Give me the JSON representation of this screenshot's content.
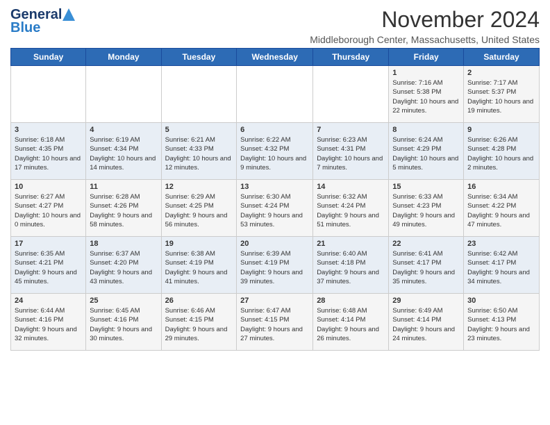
{
  "header": {
    "logo": {
      "general": "General",
      "blue": "Blue"
    },
    "title": "November 2024",
    "location": "Middleborough Center, Massachusetts, United States"
  },
  "days_of_week": [
    "Sunday",
    "Monday",
    "Tuesday",
    "Wednesday",
    "Thursday",
    "Friday",
    "Saturday"
  ],
  "weeks": [
    {
      "days": [
        {
          "num": "",
          "info": ""
        },
        {
          "num": "",
          "info": ""
        },
        {
          "num": "",
          "info": ""
        },
        {
          "num": "",
          "info": ""
        },
        {
          "num": "",
          "info": ""
        },
        {
          "num": "1",
          "info": "Sunrise: 7:16 AM\nSunset: 5:38 PM\nDaylight: 10 hours and 22 minutes."
        },
        {
          "num": "2",
          "info": "Sunrise: 7:17 AM\nSunset: 5:37 PM\nDaylight: 10 hours and 19 minutes."
        }
      ]
    },
    {
      "days": [
        {
          "num": "3",
          "info": "Sunrise: 6:18 AM\nSunset: 4:35 PM\nDaylight: 10 hours and 17 minutes."
        },
        {
          "num": "4",
          "info": "Sunrise: 6:19 AM\nSunset: 4:34 PM\nDaylight: 10 hours and 14 minutes."
        },
        {
          "num": "5",
          "info": "Sunrise: 6:21 AM\nSunset: 4:33 PM\nDaylight: 10 hours and 12 minutes."
        },
        {
          "num": "6",
          "info": "Sunrise: 6:22 AM\nSunset: 4:32 PM\nDaylight: 10 hours and 9 minutes."
        },
        {
          "num": "7",
          "info": "Sunrise: 6:23 AM\nSunset: 4:31 PM\nDaylight: 10 hours and 7 minutes."
        },
        {
          "num": "8",
          "info": "Sunrise: 6:24 AM\nSunset: 4:29 PM\nDaylight: 10 hours and 5 minutes."
        },
        {
          "num": "9",
          "info": "Sunrise: 6:26 AM\nSunset: 4:28 PM\nDaylight: 10 hours and 2 minutes."
        }
      ]
    },
    {
      "days": [
        {
          "num": "10",
          "info": "Sunrise: 6:27 AM\nSunset: 4:27 PM\nDaylight: 10 hours and 0 minutes."
        },
        {
          "num": "11",
          "info": "Sunrise: 6:28 AM\nSunset: 4:26 PM\nDaylight: 9 hours and 58 minutes."
        },
        {
          "num": "12",
          "info": "Sunrise: 6:29 AM\nSunset: 4:25 PM\nDaylight: 9 hours and 56 minutes."
        },
        {
          "num": "13",
          "info": "Sunrise: 6:30 AM\nSunset: 4:24 PM\nDaylight: 9 hours and 53 minutes."
        },
        {
          "num": "14",
          "info": "Sunrise: 6:32 AM\nSunset: 4:24 PM\nDaylight: 9 hours and 51 minutes."
        },
        {
          "num": "15",
          "info": "Sunrise: 6:33 AM\nSunset: 4:23 PM\nDaylight: 9 hours and 49 minutes."
        },
        {
          "num": "16",
          "info": "Sunrise: 6:34 AM\nSunset: 4:22 PM\nDaylight: 9 hours and 47 minutes."
        }
      ]
    },
    {
      "days": [
        {
          "num": "17",
          "info": "Sunrise: 6:35 AM\nSunset: 4:21 PM\nDaylight: 9 hours and 45 minutes."
        },
        {
          "num": "18",
          "info": "Sunrise: 6:37 AM\nSunset: 4:20 PM\nDaylight: 9 hours and 43 minutes."
        },
        {
          "num": "19",
          "info": "Sunrise: 6:38 AM\nSunset: 4:19 PM\nDaylight: 9 hours and 41 minutes."
        },
        {
          "num": "20",
          "info": "Sunrise: 6:39 AM\nSunset: 4:19 PM\nDaylight: 9 hours and 39 minutes."
        },
        {
          "num": "21",
          "info": "Sunrise: 6:40 AM\nSunset: 4:18 PM\nDaylight: 9 hours and 37 minutes."
        },
        {
          "num": "22",
          "info": "Sunrise: 6:41 AM\nSunset: 4:17 PM\nDaylight: 9 hours and 35 minutes."
        },
        {
          "num": "23",
          "info": "Sunrise: 6:42 AM\nSunset: 4:17 PM\nDaylight: 9 hours and 34 minutes."
        }
      ]
    },
    {
      "days": [
        {
          "num": "24",
          "info": "Sunrise: 6:44 AM\nSunset: 4:16 PM\nDaylight: 9 hours and 32 minutes."
        },
        {
          "num": "25",
          "info": "Sunrise: 6:45 AM\nSunset: 4:16 PM\nDaylight: 9 hours and 30 minutes."
        },
        {
          "num": "26",
          "info": "Sunrise: 6:46 AM\nSunset: 4:15 PM\nDaylight: 9 hours and 29 minutes."
        },
        {
          "num": "27",
          "info": "Sunrise: 6:47 AM\nSunset: 4:15 PM\nDaylight: 9 hours and 27 minutes."
        },
        {
          "num": "28",
          "info": "Sunrise: 6:48 AM\nSunset: 4:14 PM\nDaylight: 9 hours and 26 minutes."
        },
        {
          "num": "29",
          "info": "Sunrise: 6:49 AM\nSunset: 4:14 PM\nDaylight: 9 hours and 24 minutes."
        },
        {
          "num": "30",
          "info": "Sunrise: 6:50 AM\nSunset: 4:13 PM\nDaylight: 9 hours and 23 minutes."
        }
      ]
    }
  ]
}
